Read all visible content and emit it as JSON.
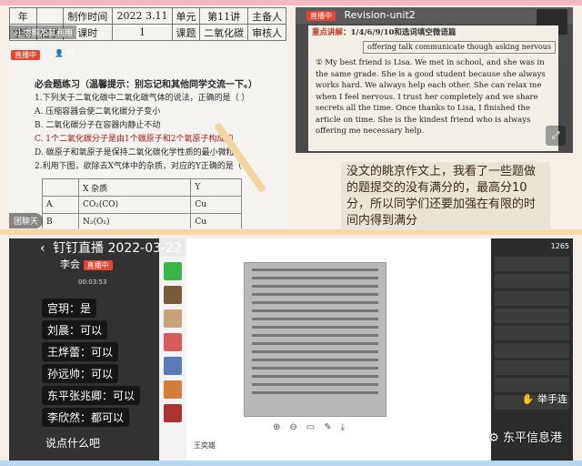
{
  "panel_top_left": {
    "live_badge": "直播中",
    "overlay_title": "习 燃料及其利用",
    "viewer_count": "89",
    "header_table": [
      [
        "年",
        "",
        "制作时间",
        "2022\n3.11",
        "单元",
        "第11讲",
        "主备人",
        ""
      ],
      [
        "学科",
        "化学",
        "课时",
        "1",
        "课题",
        "二氧化碳",
        "审核人",
        ""
      ]
    ],
    "practice_title": "必会题练习（温馨提示：别忘记和其他同学交流一下。）",
    "q1": "1.下列关于二氧化碳中二氧化碳气体的说法，正确的是（    ）",
    "q1_a": "A. 压缩容器会使二氧化碳分子变小",
    "q1_b": "B. 二氧化碳分子在容器内静止不动",
    "q1_c": "C. 1个二氧化碳分子是由1个碳原子和2个氧原子构成的",
    "q1_d": "D. 碳原子和氧原子是保持二氧化碳化学性质的最小微粒",
    "q2": "2.利用下图，欲除去X气体中的杂质，对应的Y正确的是（   ）",
    "mini_table": [
      [
        "",
        "X 杂质",
        "Y"
      ],
      [
        "A",
        "CO₂(CO)",
        "Cu"
      ],
      [
        "B",
        "N₂(O₂)",
        "Cu"
      ]
    ],
    "chat_tab": "团聊天"
  },
  "panel_top_right": {
    "live_badge": "直播中",
    "title": "Revision-unit2",
    "topic_label": "重点讲解",
    "topic_text": "：1/4/6/9/10和选词填空微语篇",
    "word_box": "offering  talk  communicate  though  asking  nervous",
    "passage": "① My best friend is Lisa. We met in school, and she was in the same grade. She is a good student because she always works hard. We always help each other. She can relax me when I feel nervous. I trust her completely and we share secrets all the time. Once thanks to Lisa, I finished the article on time. She is the kindest friend who is always offering me necessary help."
  },
  "caption": {
    "text": "没文的眺京作文上，我看了一些题做的题提交的没有满分的，最高分10分，所以同学们还要加强在有限的时间内得到满分"
  },
  "panel_bottom": {
    "app_title": "钉钉直播 2022-03-22",
    "host_name": "李会",
    "live_badge": "直播中",
    "elapsed": "00:03:53",
    "chat": [
      {
        "name": "宫玥",
        "msg": "是"
      },
      {
        "name": "刘晨",
        "msg": "可以"
      },
      {
        "name": "王烨蕾",
        "msg": "可以"
      },
      {
        "name": "孙远帅",
        "msg": "可以"
      },
      {
        "name": "东平张兆卿",
        "msg": "可以"
      },
      {
        "name": "李欣然",
        "msg": "都可以"
      }
    ],
    "input_placeholder": "说点什么吧",
    "viewer_count": "1265",
    "raise_hand": "举手连",
    "watermark": "东平信息港",
    "avatar_name": "王奕雄",
    "colors": {
      "live": "#e7452f",
      "panel": "#323232"
    }
  }
}
